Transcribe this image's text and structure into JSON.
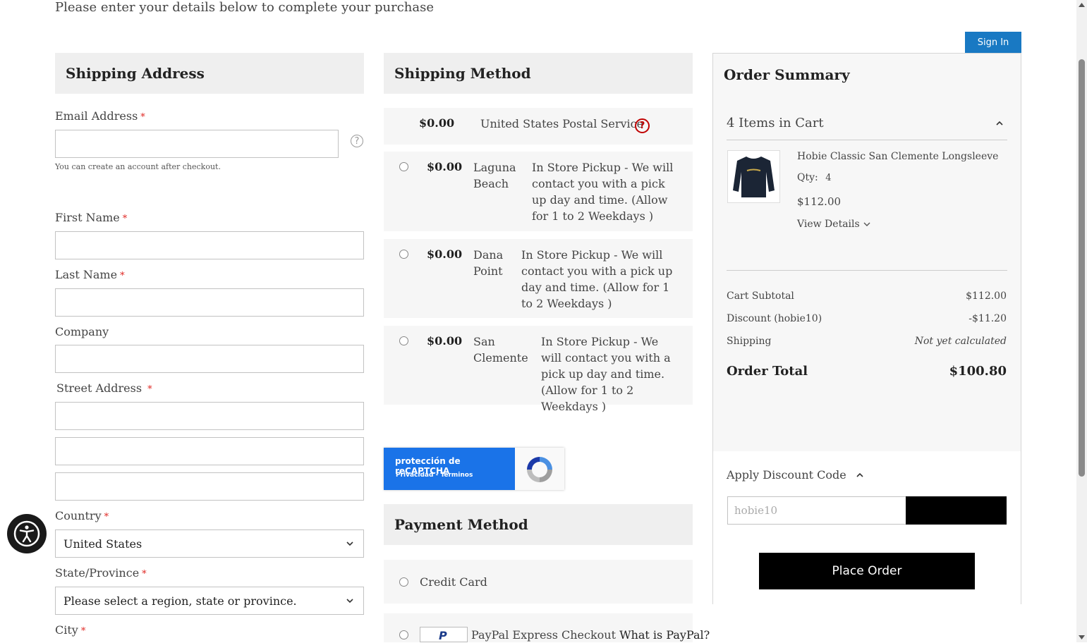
{
  "intro_text": "Please enter your details below to complete your purchase",
  "sign_in_label": "Sign In",
  "shipping_address": {
    "title": "Shipping Address",
    "email_label": "Email Address",
    "email_value": "",
    "email_note": "You can create an account after checkout.",
    "first_name_label": "First Name",
    "last_name_label": "Last Name",
    "company_label": "Company",
    "street_label": "Street Address",
    "country_label": "Country",
    "country_value": "United States",
    "state_label": "State/Province",
    "state_value": "Please select a region, state or province.",
    "city_label": "City",
    "required_mark": "*",
    "help_glyph": "?"
  },
  "shipping_method": {
    "title": "Shipping Method",
    "usps": {
      "price": "$0.00",
      "carrier": "United States Postal Service",
      "help_glyph": "?"
    },
    "options": [
      {
        "price": "$0.00",
        "location": "Laguna Beach",
        "description": "In Store Pickup - We will contact you with a pick up day and time. (Allow for 1 to 2 Weekdays )"
      },
      {
        "price": "$0.00",
        "location": "Dana Point",
        "description": "In Store Pickup - We will contact you with a pick up day and time. (Allow for 1 to 2 Weekdays )"
      },
      {
        "price": "$0.00",
        "location": "San Clemente",
        "description": "In Store Pickup - We will contact you with a pick up day and time. (Allow for 1 to 2 Weekdays )"
      }
    ]
  },
  "recaptcha": {
    "title": "protección de reCAPTCHA",
    "links": "Privacidad - Términos"
  },
  "payment_method": {
    "title": "Payment Method",
    "credit_card_label": "Credit Card",
    "paypal_label": "PayPal Express Checkout",
    "paypal_link": "What is PayPal?",
    "paypal_glyph": "P"
  },
  "order_summary": {
    "title": "Order Summary",
    "items_in_cart": "4 Items in Cart",
    "product_name": "Hobie Classic San Clemente Longsleeve",
    "qty_label": "Qty:",
    "qty_value": "4",
    "product_price": "$112.00",
    "view_details": "View Details",
    "subtotal_label": "Cart Subtotal",
    "subtotal_value": "$112.00",
    "discount_label": "Discount (hobie10)",
    "discount_value": "-$11.20",
    "shipping_label": "Shipping",
    "shipping_value": "Not yet calculated",
    "total_label": "Order Total",
    "total_value": "$100.80",
    "apply_discount_label": "Apply Discount Code",
    "discount_placeholder": "hobie10",
    "place_order_label": "Place Order"
  },
  "colors": {
    "sign_in_bg": "#1979c3",
    "recaptcha_bg": "#1a73e8",
    "required": "#e02b27",
    "help_red": "#c00000",
    "accessibility_bg": "#1a1a1a"
  },
  "icons": {
    "accessibility": "accessibility-icon",
    "help": "help-icon",
    "chevron": "chevron-down-icon"
  }
}
